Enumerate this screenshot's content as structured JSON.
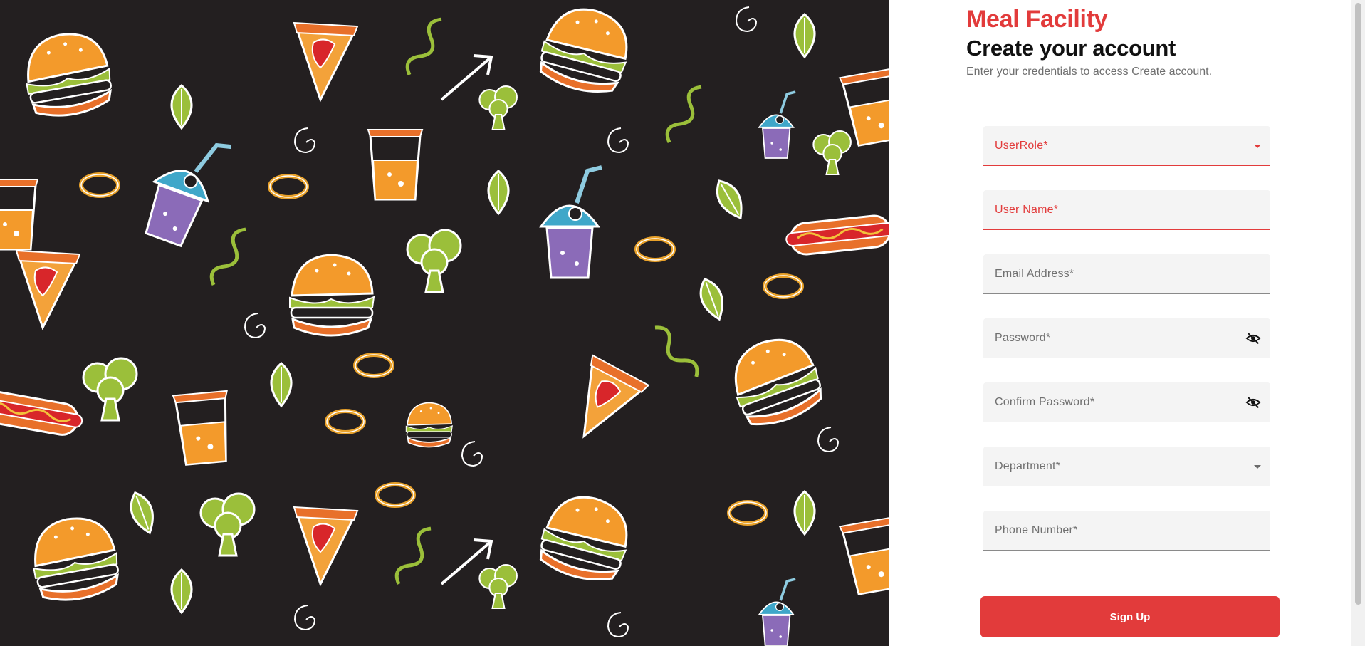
{
  "brand": {
    "name": "Meal Facility"
  },
  "header": {
    "title": "Create your account",
    "subtitle": "Enter your credentials to access Create account."
  },
  "form": {
    "fields": [
      {
        "label": "UserRole*",
        "type": "select",
        "state": "focused"
      },
      {
        "label": "User Name*",
        "type": "text",
        "state": "focused"
      },
      {
        "label": "Email Address*",
        "type": "email",
        "state": "default"
      },
      {
        "label": "Password*",
        "type": "password",
        "icon": "eye-off-icon"
      },
      {
        "label": "Confirm Password*",
        "type": "password",
        "icon": "eye-off-icon"
      },
      {
        "label": "Department*",
        "type": "select",
        "state": "default"
      },
      {
        "label": "Phone Number*",
        "type": "tel",
        "state": "default"
      }
    ],
    "submit_label": "Sign Up"
  },
  "illustration": {
    "description_icon": "food-doodle-pattern"
  },
  "colors": {
    "accent": "#e23b3b",
    "hero_background": "#231f20",
    "field_background": "#f4f4f4"
  }
}
